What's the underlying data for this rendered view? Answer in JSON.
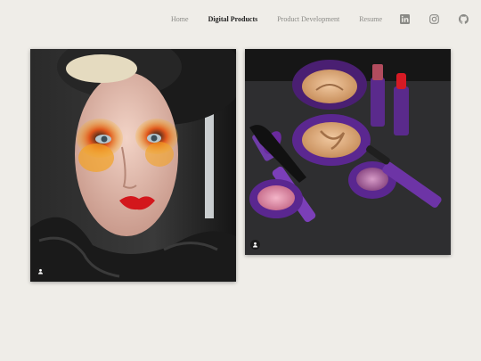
{
  "nav": {
    "links": [
      {
        "label": "Home",
        "active": false
      },
      {
        "label": "Digital Products",
        "active": true
      },
      {
        "label": "Product Development",
        "active": false
      },
      {
        "label": "Resume",
        "active": false
      }
    ],
    "social_icons": [
      "linkedin-icon",
      "instagram-icon",
      "github-icon"
    ]
  },
  "gallery": {
    "items": [
      {
        "subject": "makeup-model-portrait",
        "badge_icon": "user-icon"
      },
      {
        "subject": "cosmetics-product-flatlay",
        "badge_icon": "user-icon"
      }
    ]
  },
  "colors": {
    "background": "#efede8",
    "nav_text": "#8a8a86",
    "nav_active": "#1f1f1f",
    "product_purple": "#6a2aa0"
  }
}
